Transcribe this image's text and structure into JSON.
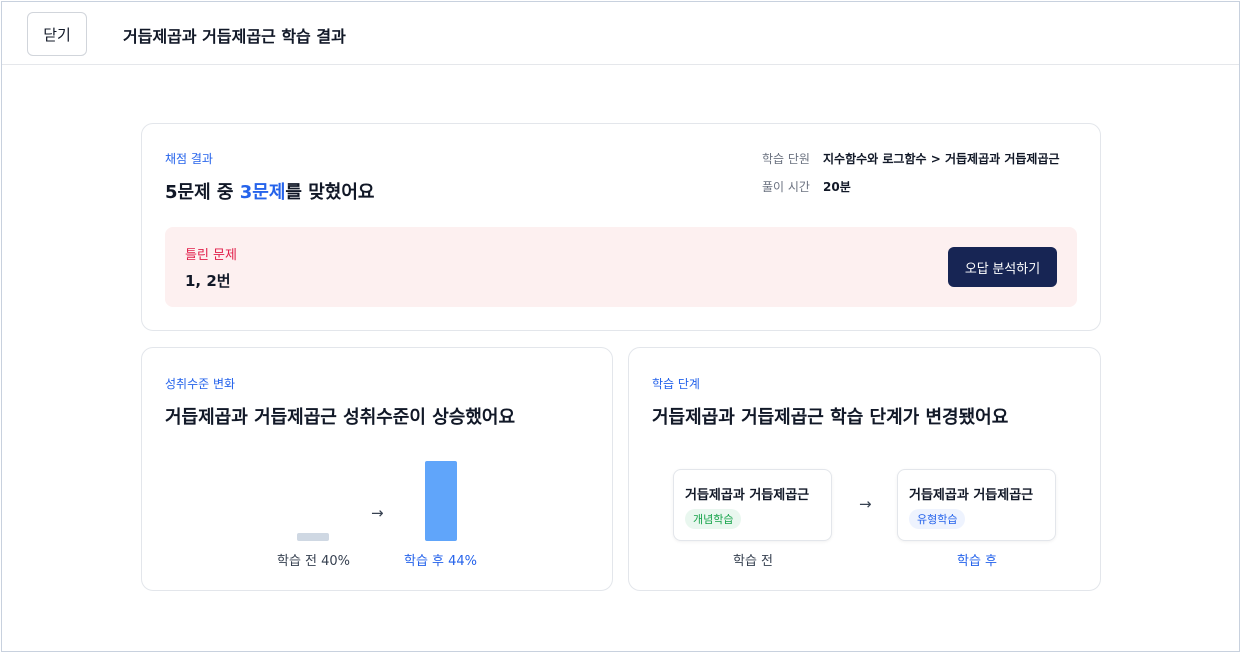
{
  "header": {
    "close_label": "닫기",
    "title": "거듭제곱과 거듭제곱근 학습 결과"
  },
  "result": {
    "eyebrow": "채점 결과",
    "headline_pre": "5문제 중 ",
    "headline_accent": "3문제",
    "headline_post": "를 맞혔어요",
    "unit_label": "학습 단원",
    "unit_value": "지수함수와 로그함수 > 거듭제곱과 거듭제곱근",
    "time_label": "풀이 시간",
    "time_value": "20분",
    "wrong_label": "틀린 문제",
    "wrong_value": "1, 2번",
    "analysis_button": "오답 분석하기"
  },
  "achievement": {
    "eyebrow": "성취수준 변화",
    "headline": "거듭제곱과 거듭제곱근 성취수준이 상승했어요",
    "before_caption": "학습 전 40%",
    "after_caption": "학습 후 44%",
    "arrow": "→",
    "before_value": 40,
    "after_value": 44,
    "before_color": "#cfd8e3",
    "after_color": "#60a5fa"
  },
  "stage": {
    "eyebrow": "학습 단계",
    "headline": "거듭제곱과 거듭제곱근 학습 단계가 변경됐어요",
    "arrow": "→",
    "before": {
      "title": "거듭제곱과 거듭제곱근",
      "tag": "개념학습",
      "caption": "학습 전"
    },
    "after": {
      "title": "거듭제곱과 거듭제곱근",
      "tag": "유형학습",
      "caption": "학습 후"
    }
  }
}
